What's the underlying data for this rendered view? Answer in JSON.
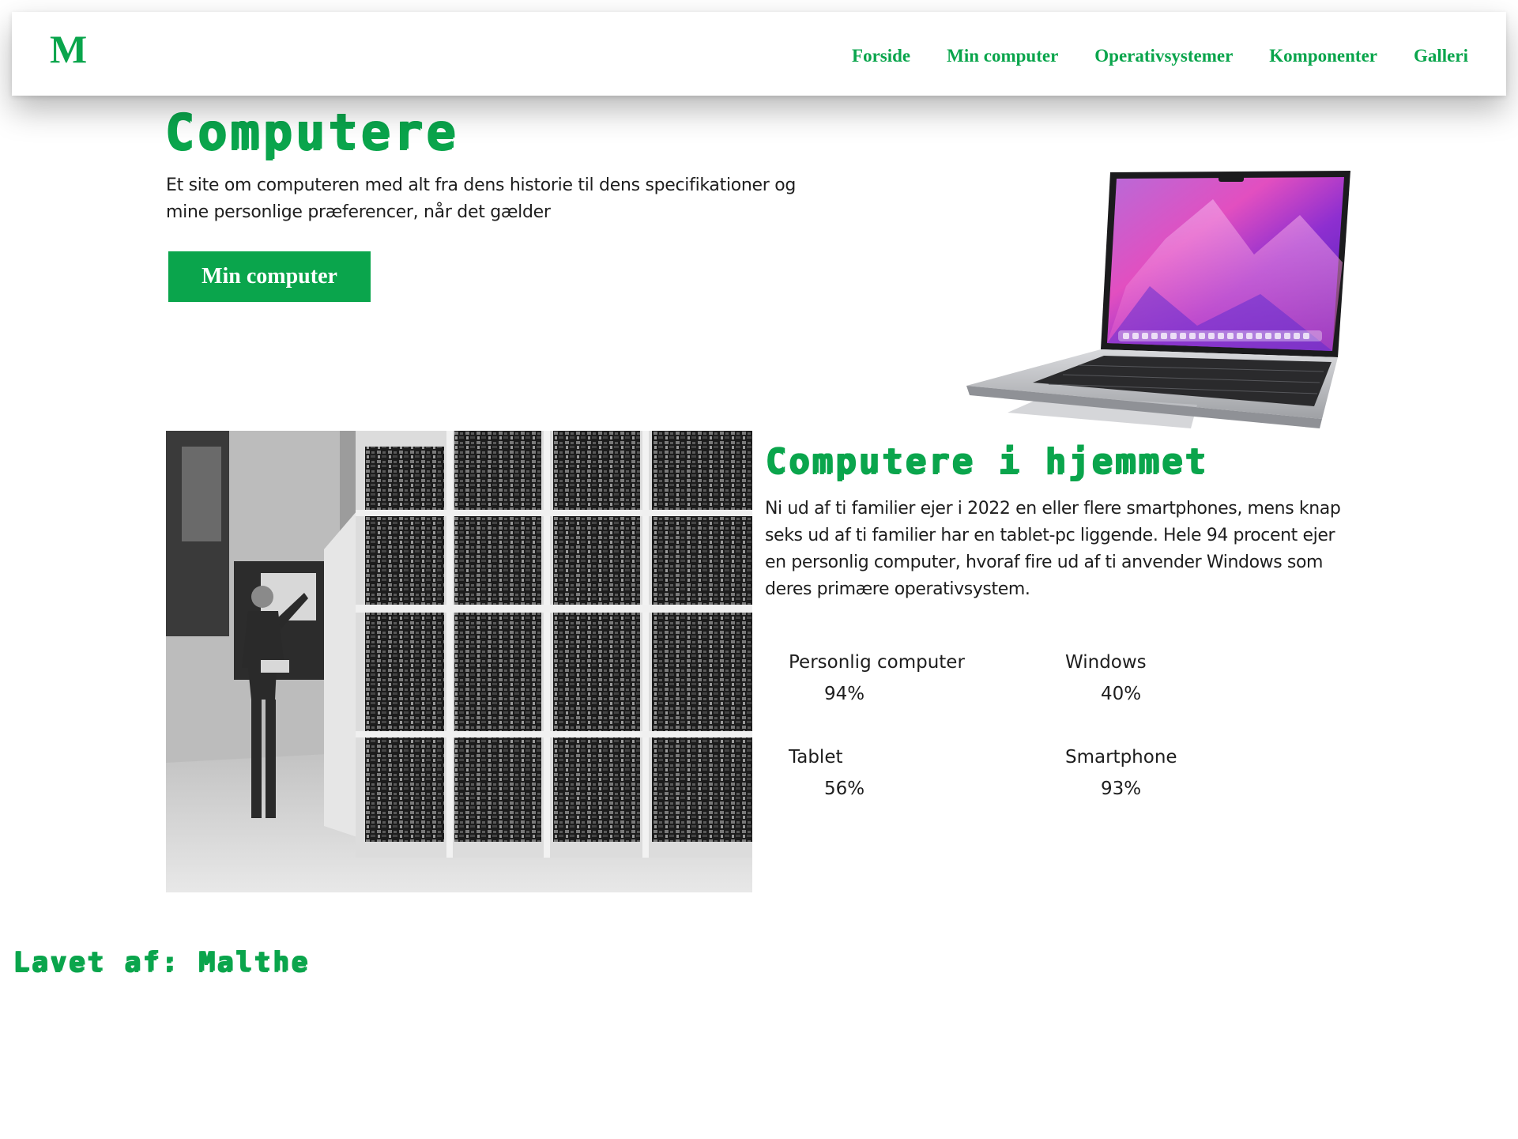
{
  "nav": {
    "logo": "M",
    "links": [
      "Forside",
      "Min computer",
      "Operativsystemer",
      "Komponenter",
      "Galleri"
    ]
  },
  "hero": {
    "title": "Computere",
    "text": "Et site om computeren med alt fra dens historie til dens specifikationer og mine personlige præferencer, når det gælder",
    "button": "Min computer"
  },
  "home": {
    "title": "Computere i hjemmet",
    "text": "Ni ud af ti familier ejer i 2022 en eller flere smartphones, mens knap seks ud af ti familier har en tablet-pc liggende. Hele 94 procent ejer en personlig computer, hvoraf fire ud af ti anvender Windows som deres primære operativsystem.",
    "stats": [
      {
        "label": "Personlig computer",
        "value": "94%"
      },
      {
        "label": "Windows",
        "value": "40%"
      },
      {
        "label": "Tablet",
        "value": "56%"
      },
      {
        "label": "Smartphone",
        "value": "93%"
      }
    ]
  },
  "footer": {
    "text": "Lavet af: Malthe"
  },
  "colors": {
    "accent": "#0aa54c",
    "text": "#1e1e1e",
    "background": "#ffffff"
  }
}
